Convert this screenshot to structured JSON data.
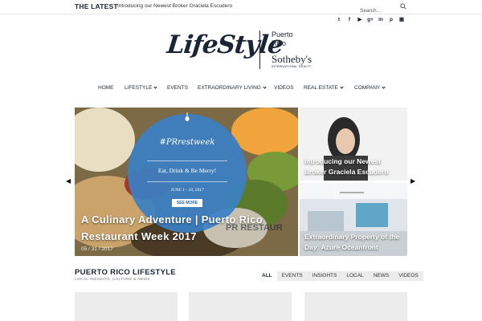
{
  "topbar": {
    "latest_label": "THE LATEST",
    "latest_headline": "Introducing our Newest Broker Graciela Escudero",
    "search_placeholder": "Search..."
  },
  "social": [
    "twitter-icon",
    "facebook-icon",
    "youtube-icon",
    "google-plus-icon",
    "linkedin-icon",
    "pinterest-icon",
    "instagram-icon"
  ],
  "logo": {
    "lifestyle": "LifeStyle",
    "region_line1": "Puerto",
    "region_line2": "Rico",
    "brand": "Sotheby's",
    "brand_sub": "INTERNATIONAL REALTY"
  },
  "nav": {
    "home": "HOME",
    "lifestyle": "LIFESTYLE",
    "events": "EVENTS",
    "extraordinary": "EXTRAORDINARY LIVING",
    "videos": "VIDEOS",
    "real_estate": "REAL ESTATE",
    "company": "COMPANY"
  },
  "slider": {
    "main": {
      "tag": "#PRrestweek",
      "subtitle": "Eat, Drink & Be Merry!",
      "event_dates": "JUNE 1 - 10, 2017",
      "see_more": "SEE MORE",
      "watermark": "PR RESTAUR",
      "title": "A Culinary Adventure | Puerto Rico Restaurant Week 2017",
      "date": "05 / 31 / 2017"
    },
    "side1_title": "Introducing our Newest Broker Graciela Escudero",
    "side2_title": "Extraordinary Property of the Day: Azure Oceanfront"
  },
  "section": {
    "title": "PUERTO RICO LIFESTYLE",
    "subtitle": "LOCAL INSIGHTS, CULTURE & NEWS",
    "filters": {
      "all": "ALL",
      "events": "EVENTS",
      "insights": "INSIGHTS",
      "local": "LOCAL",
      "news": "NEWS",
      "videos": "VIDEOS"
    },
    "active_filter": "ALL"
  },
  "colors": {
    "navy": "#1b2536",
    "circle_blue": "#3a80c4"
  }
}
